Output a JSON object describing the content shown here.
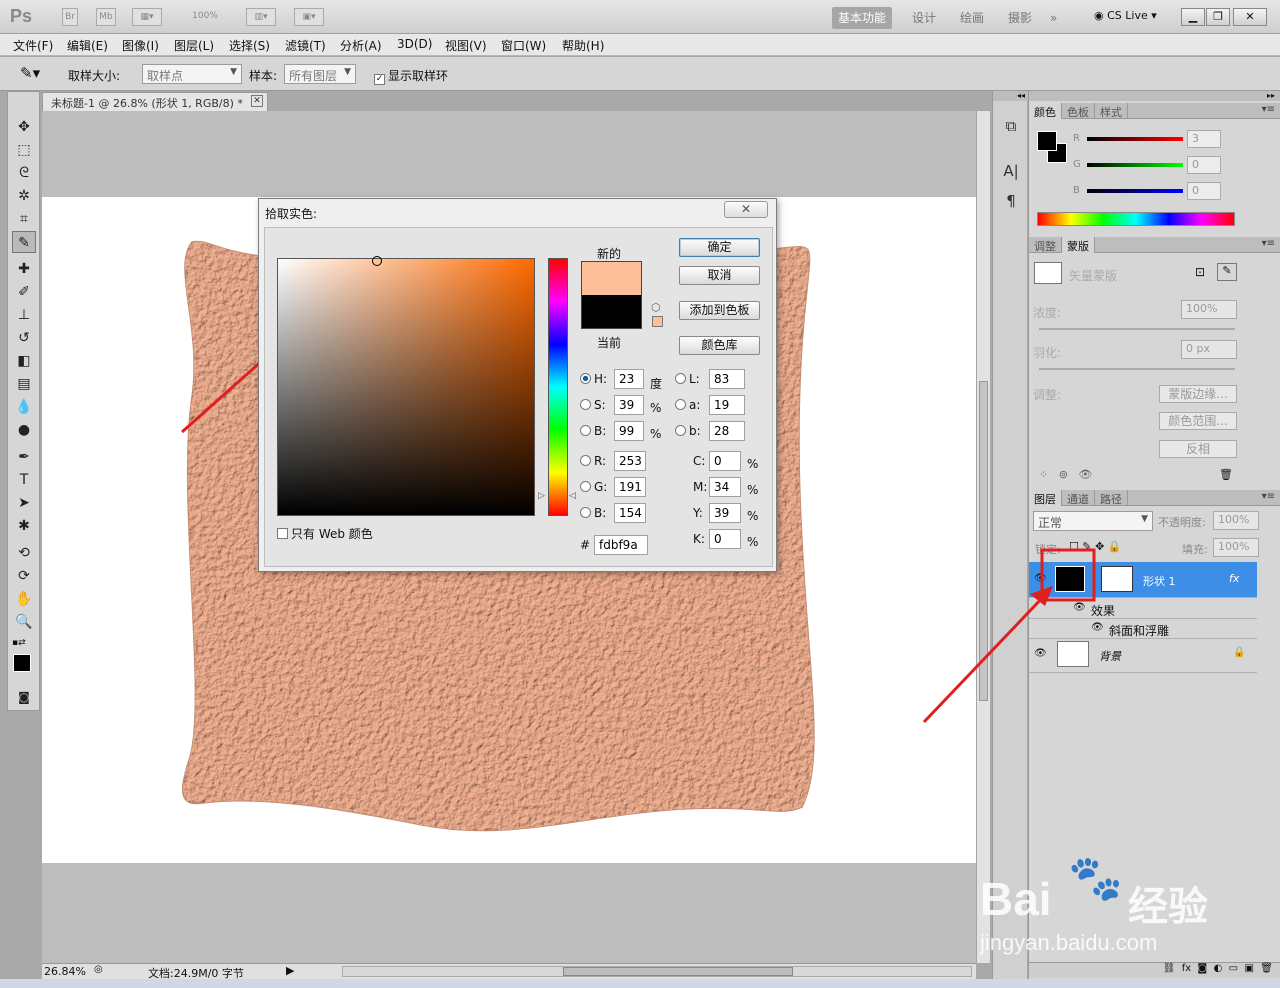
{
  "app": {
    "logo": "Ps",
    "br_label": "Br",
    "mb_label": "Mb",
    "zoom_display": "100%",
    "workspaces": [
      "基本功能",
      "设计",
      "绘画",
      "摄影"
    ],
    "cs_live": "CS Live"
  },
  "menu": [
    "文件(F)",
    "编辑(E)",
    "图像(I)",
    "图层(L)",
    "选择(S)",
    "滤镜(T)",
    "分析(A)",
    "3D(D)",
    "视图(V)",
    "窗口(W)",
    "帮助(H)"
  ],
  "options": {
    "sample_size_label": "取样大小:",
    "sample_size_value": "取样点",
    "sample_label": "样本:",
    "sample_value": "所有图层",
    "show_ring_label": "显示取样环"
  },
  "document": {
    "tab_title": "未标题-1 @ 26.8% (形状 1, RGB/8) *",
    "zoom": "26.84%",
    "doc_info": "文档:24.9M/0 字节",
    "shape_color": "#f6b494"
  },
  "color_picker": {
    "title": "拾取实色:",
    "new_label": "新的",
    "current_label": "当前",
    "new_color": "#fdbf9a",
    "current_color": "#000000",
    "ok": "确定",
    "cancel": "取消",
    "add_to_swatches": "添加到色板",
    "color_libraries": "颜色库",
    "web_only": "只有 Web 颜色",
    "H": "23",
    "S": "39",
    "B": "99",
    "R": "253",
    "G": "191",
    "Bl": "154",
    "L": "83",
    "a": "19",
    "b": "28",
    "C": "0",
    "M": "34",
    "Y": "39",
    "K": "0",
    "hex_label": "#",
    "hex": "fdbf9a",
    "unit_deg": "度",
    "unit_pct": "%"
  },
  "panels": {
    "color_tabs": [
      "颜色",
      "色板",
      "样式"
    ],
    "rgb_labels": [
      "R",
      "G",
      "B"
    ],
    "rgb_values": [
      "3",
      "0",
      "0"
    ],
    "mask_tabs": [
      "调整",
      "蒙版"
    ],
    "vector_mask": "矢量蒙版",
    "density_label": "浓度:",
    "density_value": "100%",
    "feather_label": "羽化:",
    "feather_value": "0 px",
    "refine_label": "调整:",
    "mask_edge": "蒙版边缘...",
    "color_range": "颜色范围...",
    "invert": "反相",
    "layer_tabs": [
      "图层",
      "通道",
      "路径"
    ],
    "blend_mode": "正常",
    "opacity_label": "不透明度:",
    "opacity_value": "100%",
    "lock_label": "锁定:",
    "fill_label": "填充:",
    "fill_value": "100%",
    "layers": [
      {
        "name": "形状 1",
        "fx": "fx"
      },
      {
        "name": "效果"
      },
      {
        "name": "斜面和浮雕"
      },
      {
        "name": "背景"
      }
    ]
  },
  "watermark": {
    "brand": "Bai",
    "brand2": "经验",
    "url": "jingyan.baidu.com"
  }
}
